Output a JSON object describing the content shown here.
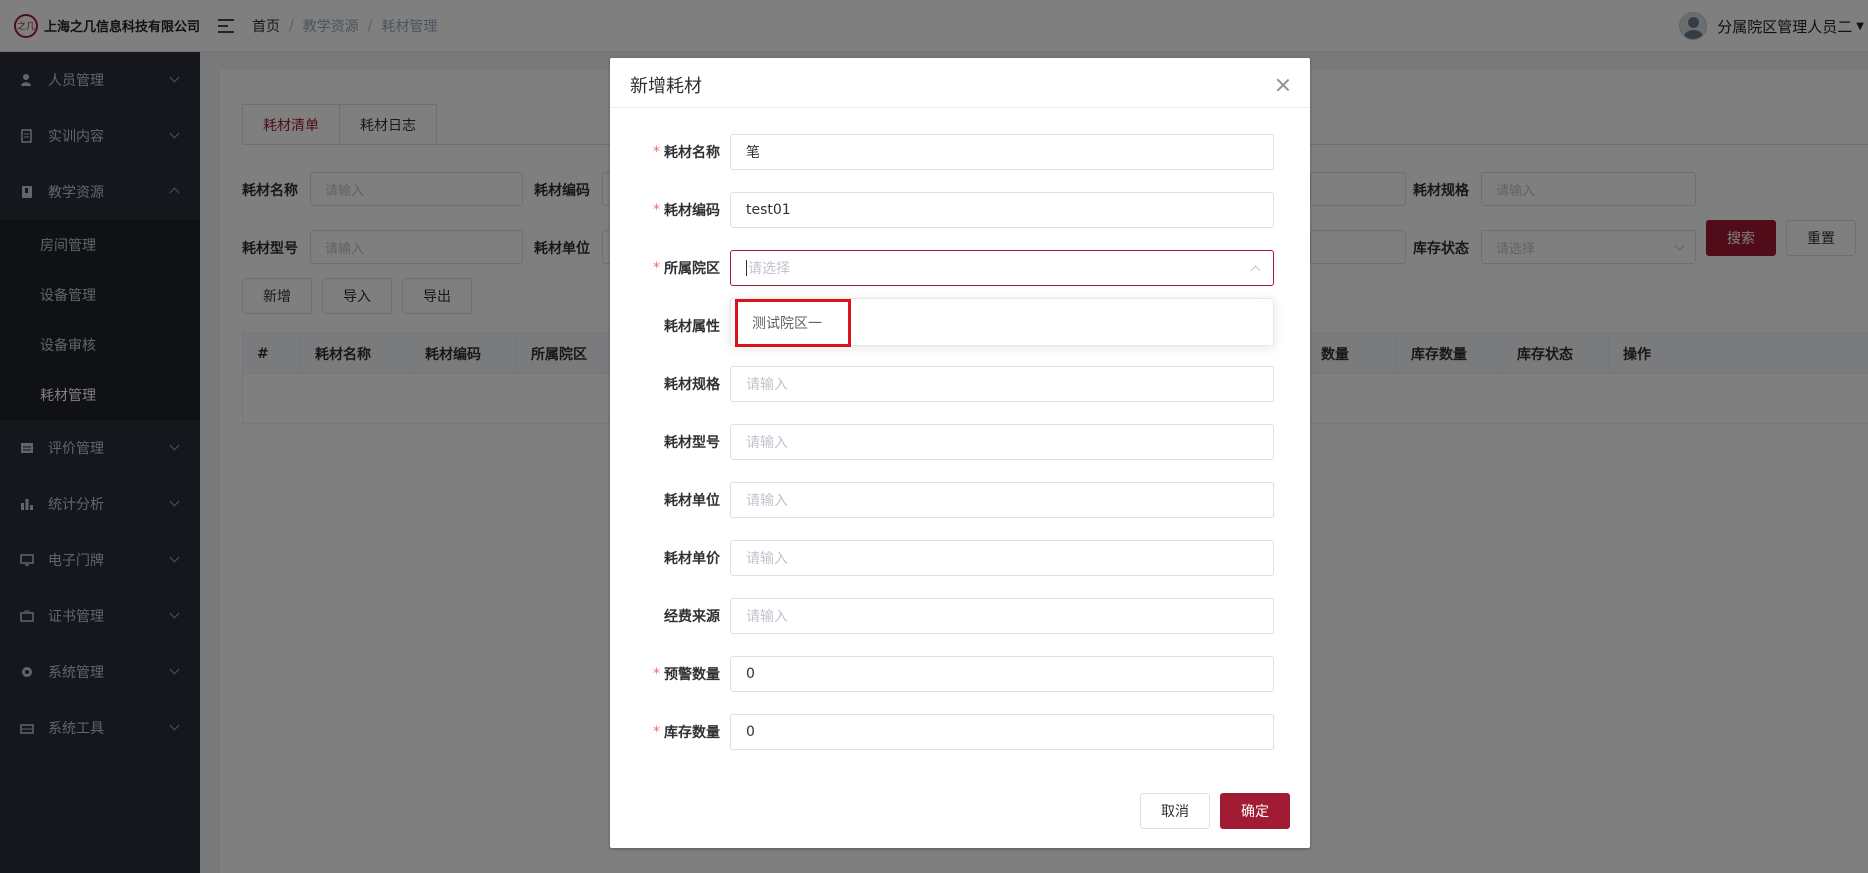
{
  "header": {
    "logo_mark": "之几",
    "company": "上海之几信息科技有限公司",
    "breadcrumb": [
      "首页",
      "教学资源",
      "耗材管理"
    ],
    "user_name": "分属院区管理人员二"
  },
  "sidebar": {
    "items": [
      {
        "label": "人员管理",
        "icon": "user-icon"
      },
      {
        "label": "实训内容",
        "icon": "document-icon"
      },
      {
        "label": "教学资源",
        "icon": "book-icon",
        "expanded": true,
        "children": [
          "房间管理",
          "设备管理",
          "设备审核",
          "耗材管理"
        ],
        "active_child": "耗材管理"
      },
      {
        "label": "评价管理",
        "icon": "list-icon"
      },
      {
        "label": "统计分析",
        "icon": "bar-chart-icon"
      },
      {
        "label": "电子门牌",
        "icon": "monitor-icon"
      },
      {
        "label": "证书管理",
        "icon": "briefcase-icon"
      },
      {
        "label": "系统管理",
        "icon": "gear-icon"
      },
      {
        "label": "系统工具",
        "icon": "toolbox-icon"
      }
    ]
  },
  "main": {
    "tabs": [
      {
        "label": "耗材清单",
        "active": true
      },
      {
        "label": "耗材日志",
        "active": false
      }
    ],
    "filters_row1": [
      {
        "label": "耗材名称",
        "placeholder": "请输入"
      },
      {
        "label": "耗材编码",
        "placeholder": ""
      },
      {
        "label": "耗材规格",
        "placeholder": "请输入"
      }
    ],
    "filters_row2": [
      {
        "label": "耗材型号",
        "placeholder": "请输入"
      },
      {
        "label": "耗材单位",
        "placeholder": ""
      },
      {
        "label": "库存状态",
        "placeholder": "请选择"
      }
    ],
    "search_label": "搜索",
    "reset_label": "重置",
    "actions": [
      "新增",
      "导入",
      "导出"
    ],
    "table_headers_left": [
      "#",
      "耗材名称",
      "耗材编码",
      "所属院区"
    ],
    "table_headers_right": [
      "数量",
      "库存数量",
      "库存状态",
      "操作"
    ]
  },
  "dialog": {
    "title": "新增耗材",
    "fields": [
      {
        "label": "耗材名称",
        "required": true,
        "value": "笔",
        "placeholder": ""
      },
      {
        "label": "耗材编码",
        "required": true,
        "value": "test01",
        "placeholder": ""
      },
      {
        "label": "所属院区",
        "required": true,
        "value": "",
        "placeholder": "请选择"
      },
      {
        "label": "耗材属性",
        "required": false,
        "value": "",
        "placeholder": ""
      },
      {
        "label": "耗材规格",
        "required": false,
        "value": "",
        "placeholder": "请输入"
      },
      {
        "label": "耗材型号",
        "required": false,
        "value": "",
        "placeholder": "请输入"
      },
      {
        "label": "耗材单位",
        "required": false,
        "value": "",
        "placeholder": "请输入"
      },
      {
        "label": "耗材单价",
        "required": false,
        "value": "",
        "placeholder": "请输入"
      },
      {
        "label": "经费来源",
        "required": false,
        "value": "",
        "placeholder": "请输入"
      },
      {
        "label": "预警数量",
        "required": true,
        "value": "0",
        "placeholder": ""
      },
      {
        "label": "库存数量",
        "required": true,
        "value": "0",
        "placeholder": ""
      }
    ],
    "dropdown_options": [
      "测试院区一"
    ],
    "cancel_label": "取消",
    "confirm_label": "确定"
  },
  "colors": {
    "accent": "#a11b32",
    "sidebar_bg": "#2b2f3a",
    "highlight_box": "#d9141b"
  }
}
